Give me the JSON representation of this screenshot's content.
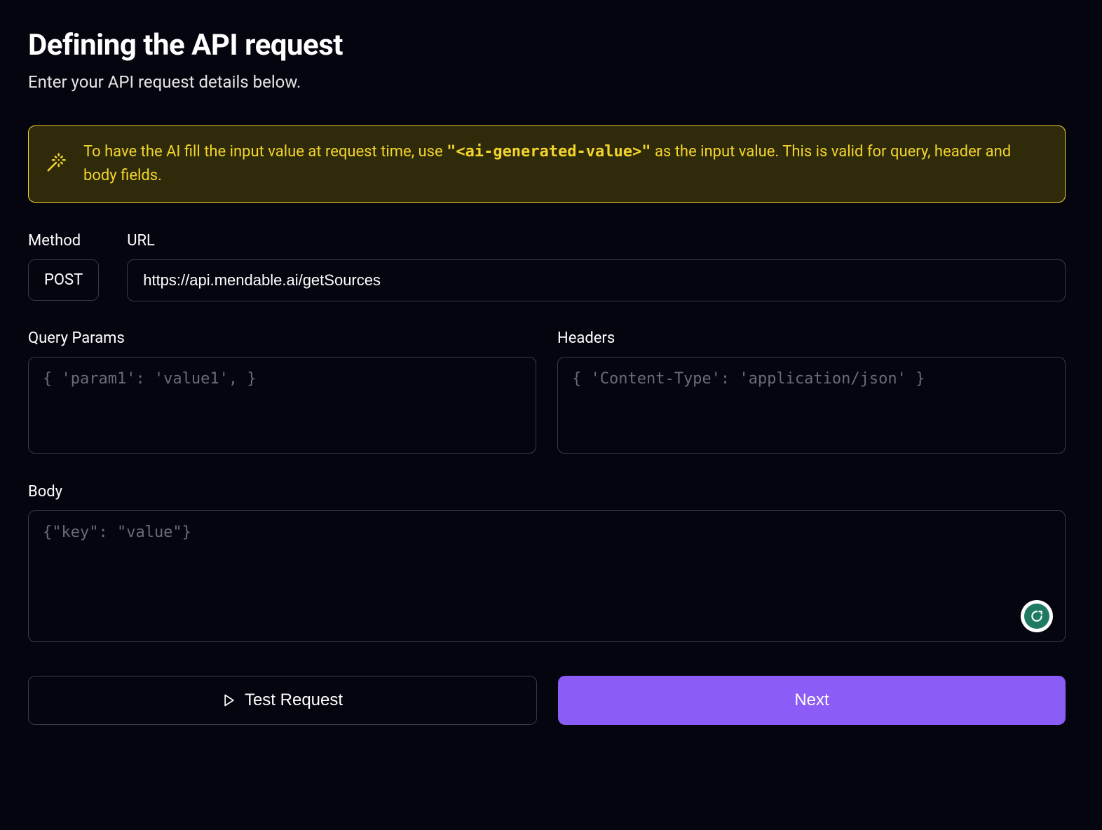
{
  "header": {
    "title": "Defining the API request",
    "subtitle": "Enter your API request details below."
  },
  "tip": {
    "prefix": "To have the AI fill the input value at request time, use ",
    "code": "\"<ai-generated-value>\"",
    "suffix": " as the input value. This is valid for query, header and body fields."
  },
  "form": {
    "method_label": "Method",
    "method_value": "POST",
    "url_label": "URL",
    "url_value": "https://api.mendable.ai/getSources",
    "query_label": "Query Params",
    "query_placeholder": "{ 'param1': 'value1', }",
    "headers_label": "Headers",
    "headers_placeholder": "{ 'Content-Type': 'application/json' }",
    "body_label": "Body",
    "body_placeholder": "{\"key\": \"value\"}"
  },
  "buttons": {
    "test_label": "Test Request",
    "next_label": "Next"
  }
}
